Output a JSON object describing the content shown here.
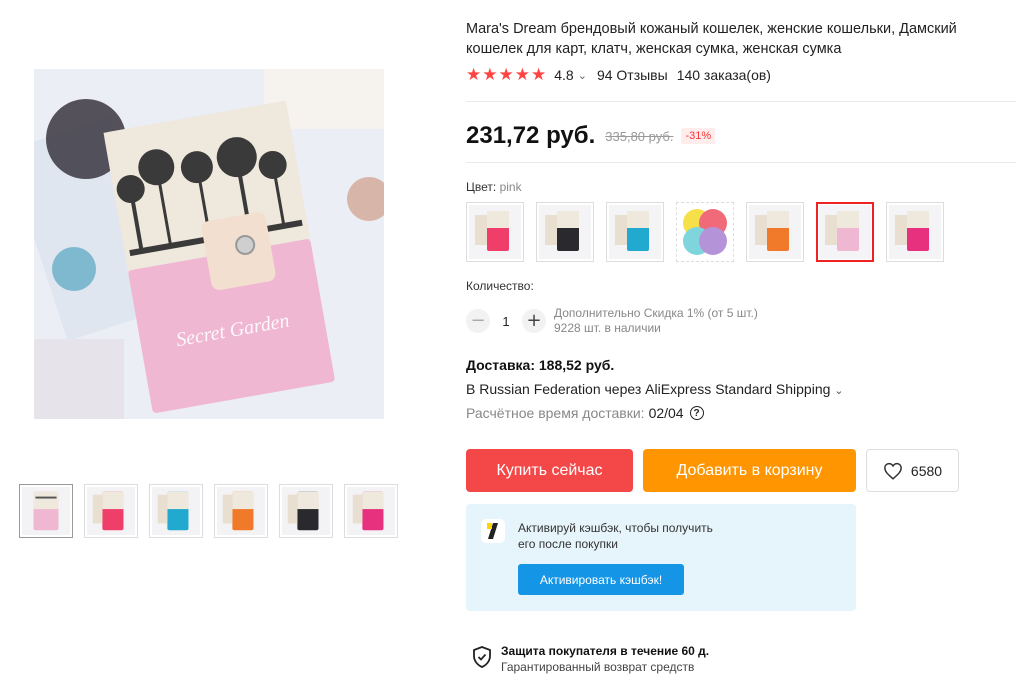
{
  "product": {
    "title": "Mara's Dream брендовый кожаный кошелек, женские кошельки, Дамский кошелек для карт, клатч, женская сумка, женская сумка",
    "rating": "4.8",
    "reviews": "94 Отзывы",
    "orders": "140 заказа(ов)",
    "rating_stars": 5
  },
  "price": {
    "current": "231,72 руб.",
    "old": "335,80 руб.",
    "discount": "-31%"
  },
  "color": {
    "label": "Цвет:",
    "selected": "pink",
    "swatches": [
      "red",
      "black",
      "blue",
      "multicolor",
      "orange",
      "pink",
      "hot-pink"
    ],
    "selected_index": 5
  },
  "quantity": {
    "label": "Количество:",
    "value": "1",
    "discount_note": "Дополнительно Скидка 1% (от 5 шт.)",
    "stock": "9228 шт. в наличии"
  },
  "shipping": {
    "title": "Доставка: 188,52 руб.",
    "method": "В Russian Federation через AliExpress Standard Shipping",
    "eta_label": "Расчётное время доставки:",
    "eta_date": "02/04"
  },
  "actions": {
    "buy_now": "Купить сейчас",
    "add_to_cart": "Добавить в корзину",
    "wishlist_count": "6580"
  },
  "cashback": {
    "text_line1": "Активируй кэшбэк, чтобы получить",
    "text_line2": "его после покупки",
    "button": "Активировать кэшбэк!"
  },
  "protection": {
    "title": "Защита покупателя в течение 60 д.",
    "subtitle": "Гарантированный возврат средств"
  },
  "gallery": {
    "thumb_colors": [
      "pink",
      "red",
      "blue",
      "orange",
      "black",
      "hot-pink"
    ],
    "active_index": 0
  },
  "colors": {
    "accent_red": "#f44848",
    "accent_orange": "#ff9500",
    "cashback_blue": "#1595e6",
    "star": "#ff4444"
  }
}
